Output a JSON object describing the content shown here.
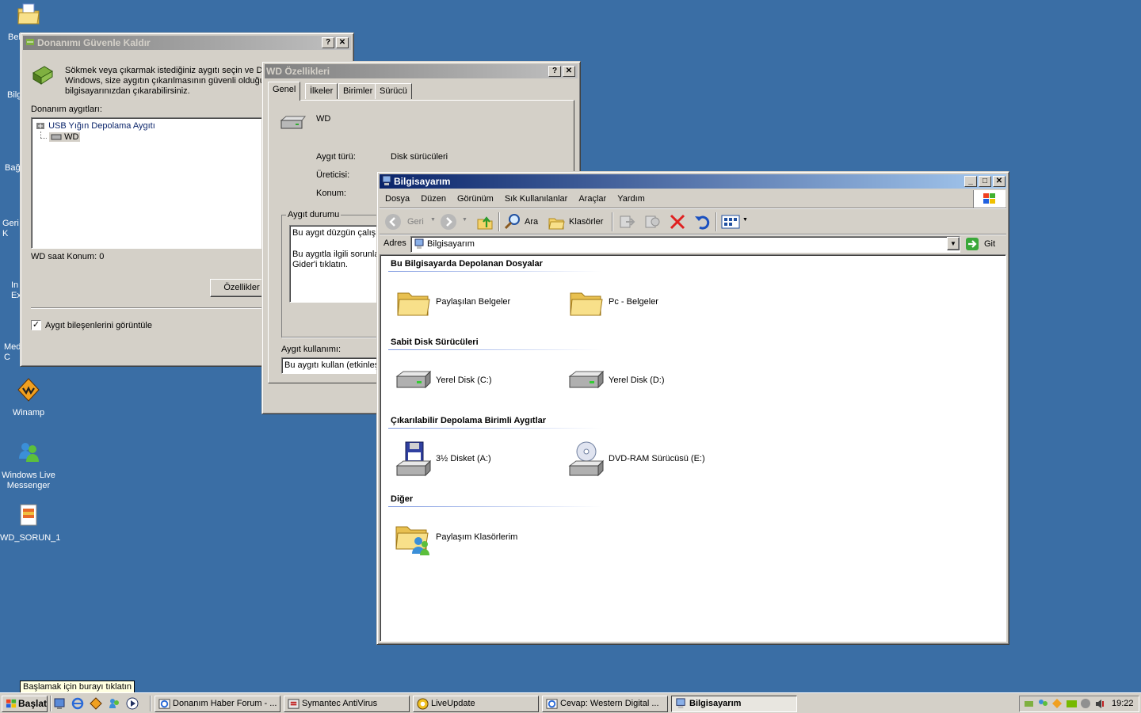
{
  "desktop": {
    "icons": [
      {
        "label": "Bel"
      },
      {
        "label": "Bilg"
      },
      {
        "label": "Bağ"
      },
      {
        "label": "Geri K"
      },
      {
        "label": "In Ex"
      },
      {
        "label": "Med C"
      },
      {
        "label": "Winamp"
      },
      {
        "label": "Windows Live Messenger"
      },
      {
        "label": "WD_SORUN_1"
      }
    ]
  },
  "safe_remove": {
    "title": "Donanımı Güvenle Kaldır",
    "help": "?",
    "close": "✕",
    "description": "Sökmek veya çıkarmak istediğiniz aygıtı seçin ve Dur Windows, size aygıtın çıkarılmasının güvenli olduğunu bilgisayarınızdan çıkarabilirsiniz.",
    "devices_label": "Donanım aygıtları:",
    "tree": [
      {
        "label": "USB Yığın Depolama Aygıtı",
        "level": 0
      },
      {
        "label": "WD",
        "level": 1
      }
    ],
    "status": "WD  saat Konum: 0",
    "properties_button": "Özellikler",
    "checkbox_label": "Aygıt bileşenlerini görüntüle",
    "checkbox_checked": true
  },
  "wd_props": {
    "title": "WD  Özellikleri",
    "help": "?",
    "close": "✕",
    "tabs": [
      "Genel",
      "İlkeler",
      "Birimler",
      "Sürücü"
    ],
    "device_name": "WD",
    "type_label": "Aygıt türü:",
    "type_value": "Disk sürücüleri",
    "manufacturer_label": "Üreticisi:",
    "location_label": "Konum:",
    "status_group": "Aygıt durumu",
    "status_text1": "Bu aygıt düzgün çalışıy",
    "status_text2": "Bu aygıtla ilgili sorunlar",
    "status_text3": "Gider'i tıklatın.",
    "usage_label": "Aygıt kullanımı:",
    "usage_value": "Bu aygıtı kullan (etkinleşt"
  },
  "explorer": {
    "title": "Bilgisayarım",
    "minimize": "_",
    "maximize": "□",
    "close": "✕",
    "menu": [
      "Dosya",
      "Düzen",
      "Görünüm",
      "Sık Kullanılanlar",
      "Araçlar",
      "Yardım"
    ],
    "toolbar": {
      "back": "Geri",
      "search": "Ara",
      "folders": "Klasörler"
    },
    "address_label": "Adres",
    "address_value": "Bilgisayarım",
    "go_label": "Git",
    "sections": [
      {
        "title": "Bu Bilgisayarda Depolanan Dosyalar",
        "items": [
          {
            "label": "Paylaşılan Belgeler",
            "icon": "folder-icon"
          },
          {
            "label": "Pc - Belgeler",
            "icon": "folder-icon"
          }
        ]
      },
      {
        "title": "Sabit Disk Sürücüleri",
        "items": [
          {
            "label": "Yerel Disk (C:)",
            "icon": "hard-disk-icon"
          },
          {
            "label": "Yerel Disk (D:)",
            "icon": "hard-disk-icon"
          }
        ]
      },
      {
        "title": "Çıkarılabilir Depolama Birimli Aygıtlar",
        "items": [
          {
            "label": "3½ Disket (A:)",
            "icon": "floppy-icon"
          },
          {
            "label": "DVD-RAM Sürücüsü (E:)",
            "icon": "dvd-drive-icon"
          }
        ]
      },
      {
        "title": "Diğer",
        "items": [
          {
            "label": "Paylaşım Klasörlerim",
            "icon": "shared-folder-icon"
          }
        ]
      }
    ]
  },
  "tooltip": "Başlamak için burayı tıklatın",
  "taskbar": {
    "start": "Başlat",
    "items": [
      {
        "label": "Donanım Haber Forum - ...",
        "pressed": false
      },
      {
        "label": "Symantec AntiVirus",
        "pressed": false
      },
      {
        "label": "LiveUpdate",
        "pressed": false
      },
      {
        "label": "Cevap: Western Digital ...",
        "pressed": false
      },
      {
        "label": "Bilgisayarım",
        "pressed": true
      }
    ],
    "clock": "19:22"
  }
}
